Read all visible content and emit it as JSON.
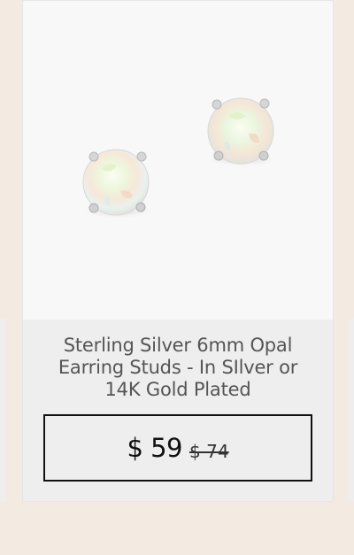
{
  "product": {
    "title": "Sterling Silver 6mm Opal Earring Studs - In SIlver or 14K Gold Plated",
    "price_current": "$ 59",
    "price_original": "$ 74",
    "image_icon": "opal-earring-studs-image"
  },
  "colors": {
    "page_background": "#f3ebe1",
    "card_background": "#eeeeee",
    "image_background": "#f8f8f8",
    "title_text": "#555555",
    "price_border": "#111111"
  }
}
